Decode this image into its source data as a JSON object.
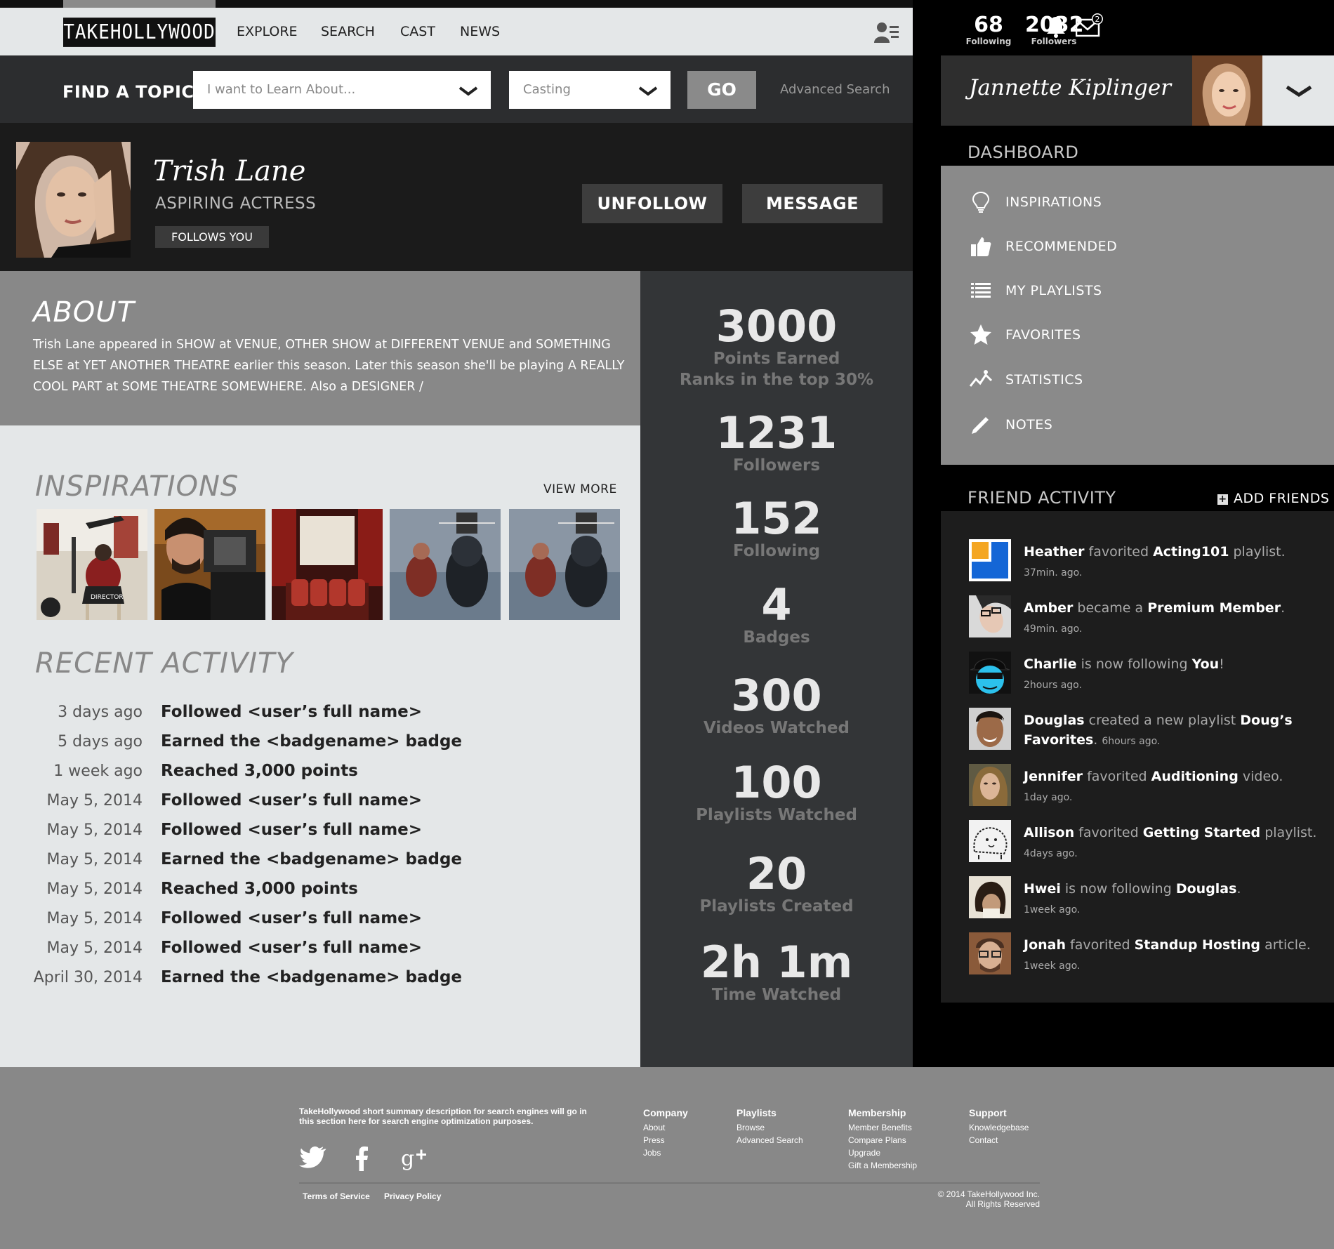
{
  "nav": {
    "logo": "TAKEHOLLYWOOD",
    "links": [
      "EXPLORE",
      "SEARCH",
      "CAST",
      "NEWS"
    ]
  },
  "find": {
    "label": "FIND A TOPIC",
    "topic_placeholder": "I want to Learn About...",
    "category_placeholder": "Casting",
    "go_label": "GO",
    "advanced_label": "Advanced Search"
  },
  "profile": {
    "name": "Trish Lane",
    "title": "ASPIRING ACTRESS",
    "follows_badge": "FOLLOWS YOU",
    "unfollow_label": "UNFOLLOW",
    "message_label": "MESSAGE"
  },
  "about": {
    "title": "ABOUT",
    "text": "Trish Lane appeared in SHOW at VENUE, OTHER SHOW at DIFFERENT VENUE and SOMETHING ELSE at YET ANOTHER THEATRE earlier this season.  Later this season she'll be playing A REALLY COOL PART at SOME THEATRE SOMEWHERE.  Also a DESIGNER /"
  },
  "inspirations": {
    "title": "INSPIRATIONS",
    "view_more": "VIEW MORE",
    "director_chair_text": "DIRECTOR"
  },
  "recent_activity": {
    "title": "RECENT ACTIVITY",
    "items": [
      {
        "date": "3 days ago",
        "text": "Followed <user’s full name>"
      },
      {
        "date": "5 days ago",
        "text": "Earned the <badgename> badge"
      },
      {
        "date": "1 week ago",
        "text": "Reached 3,000 points"
      },
      {
        "date": "May 5, 2014",
        "text": "Followed <user’s full name>"
      },
      {
        "date": "May 5, 2014",
        "text": "Followed <user’s full name>"
      },
      {
        "date": "May 5, 2014",
        "text": "Earned the <badgename> badge"
      },
      {
        "date": "May 5, 2014",
        "text": "Reached 3,000 points"
      },
      {
        "date": "May 5, 2014",
        "text": "Followed <user’s full name>"
      },
      {
        "date": "May 5, 2014",
        "text": "Followed <user’s full name>"
      },
      {
        "date": "April 30, 2014",
        "text": "Earned the <badgename> badge"
      }
    ]
  },
  "stats": [
    {
      "num": "3000",
      "label": "Points Earned",
      "sub": "Ranks in the top 30%"
    },
    {
      "num": "1231",
      "label": "Followers"
    },
    {
      "num": "152",
      "label": "Following"
    },
    {
      "num": "4",
      "label": "Badges"
    },
    {
      "num": "300",
      "label": "Videos Watched"
    },
    {
      "num": "100",
      "label": "Playlists Watched"
    },
    {
      "num": "20",
      "label": "Playlists Created"
    },
    {
      "num": "2h 1m",
      "label": "Time Watched"
    }
  ],
  "account": {
    "following_count": "68",
    "following_label": "Following",
    "followers_count": "2032",
    "followers_label": "Followers",
    "mail_badge": "2",
    "user_name": "Jannette Kiplinger"
  },
  "dashboard": {
    "title": "DASHBOARD",
    "items": [
      {
        "label": "INSPIRATIONS",
        "icon": "lightbulb-icon"
      },
      {
        "label": "RECOMMENDED",
        "icon": "thumbs-up-icon"
      },
      {
        "label": "MY PLAYLISTS",
        "icon": "list-icon"
      },
      {
        "label": "FAVORITES",
        "icon": "star-icon"
      },
      {
        "label": "STATISTICS",
        "icon": "chart-line-icon"
      },
      {
        "label": "NOTES",
        "icon": "pencil-icon"
      }
    ]
  },
  "friend_activity": {
    "title": "FRIEND ACTIVITY",
    "add_label": "ADD FRIENDS",
    "items": [
      {
        "name": "Heather",
        "action": "favorited",
        "object": "Acting101",
        "suffix": "playlist.",
        "time": "37min. ago."
      },
      {
        "name": "Amber",
        "action": "became a",
        "object": "Premium Member",
        "suffix": ".",
        "time": "49min. ago."
      },
      {
        "name": "Charlie",
        "action": "is now following",
        "object": "You",
        "suffix": "!",
        "time": "2hours ago."
      },
      {
        "name": "Douglas",
        "action": "created a new playlist",
        "object": "Doug’s Favorites",
        "suffix": ".",
        "time": "6hours ago."
      },
      {
        "name": "Jennifer",
        "action": "favorited",
        "object": "Auditioning",
        "suffix": "video.",
        "time": "1day ago."
      },
      {
        "name": "Allison",
        "action": "favorited",
        "object": "Getting Started",
        "suffix": "playlist.",
        "time": "4days ago."
      },
      {
        "name": "Hwei",
        "action": "is now following",
        "object": "Douglas",
        "suffix": ".",
        "time": "1week ago."
      },
      {
        "name": "Jonah",
        "action": "favorited",
        "object": "Standup Hosting",
        "suffix": "article.",
        "time": "1week ago."
      }
    ]
  },
  "footer": {
    "description": "TakeHollywood short summary description for  search engines will go in this section here for search engine optimization purposes.",
    "columns": [
      {
        "heading": "Company",
        "links": [
          "About",
          "Press",
          "Jobs"
        ]
      },
      {
        "heading": "Playlists",
        "links": [
          "Browse",
          "Advanced Search"
        ]
      },
      {
        "heading": "Membership",
        "links": [
          "Member Benefits",
          "Compare Plans",
          "Upgrade",
          "Gift a Membership"
        ]
      },
      {
        "heading": "Support",
        "links": [
          "Knowledgebase",
          "Contact"
        ]
      }
    ],
    "terms": "Terms of Service",
    "privacy": "Privacy Policy",
    "copyright_line1": "© 2014 TakeHollywood Inc.",
    "copyright_line2": "All Rights Reserved"
  },
  "colors": {
    "nav_bg": "#e4e7e8",
    "dark_bar": "#2c2d2f",
    "profile_bg": "#1b1b1b",
    "about_bg": "#888888",
    "stats_bg": "#333537",
    "sidebar_bg": "#000000",
    "friend_panel_bg": "#1d1d1d",
    "footer_bg": "#888888",
    "heather_orange": "#f4a623",
    "heather_blue": "#1466d6",
    "charlie_cyan": "#2cc1ec"
  }
}
